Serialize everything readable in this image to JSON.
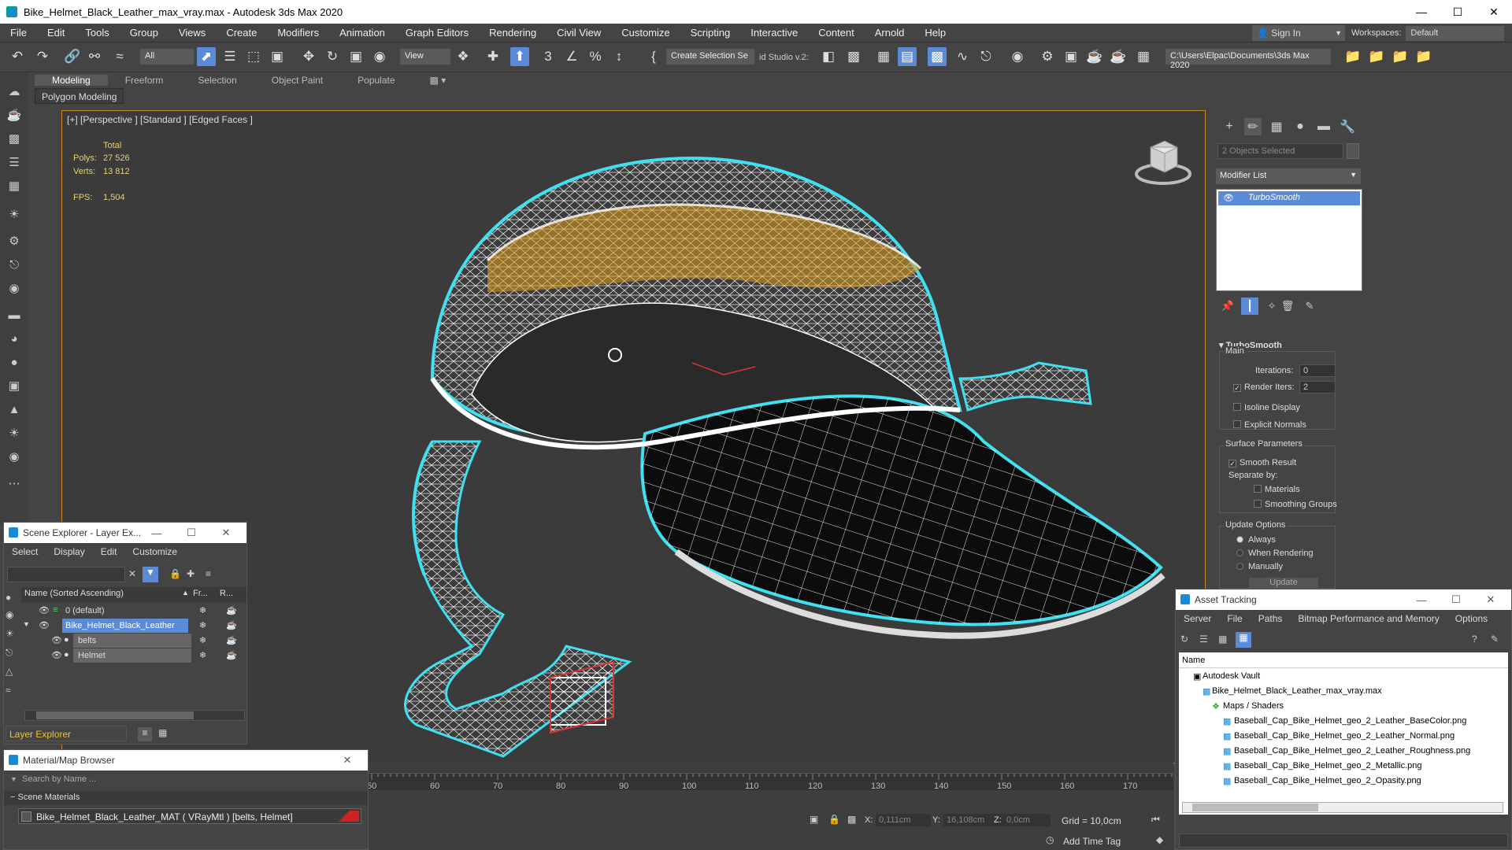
{
  "window": {
    "title": "Bike_Helmet_Black_Leather_max_vray.max - Autodesk 3ds Max 2020"
  },
  "menus": [
    "File",
    "Edit",
    "Tools",
    "Group",
    "Views",
    "Create",
    "Modifiers",
    "Animation",
    "Graph Editors",
    "Rendering",
    "Civil View",
    "Customize",
    "Scripting",
    "Interactive",
    "Content",
    "Arnold",
    "Help"
  ],
  "account": {
    "signin": "Sign In",
    "workspaces_label": "Workspaces:",
    "workspace": "Default"
  },
  "toolbar": {
    "filter": "All",
    "refcoord": "View",
    "selset": "Create Selection Se",
    "studio": "id Studio v.2:",
    "path": "C:\\Users\\Elpac\\Documents\\3ds Max 2020"
  },
  "ribbon": {
    "tabs": [
      "Modeling",
      "Freeform",
      "Selection",
      "Object Paint",
      "Populate"
    ],
    "sub": "Polygon Modeling"
  },
  "viewport": {
    "label": "[+] [Perspective ] [Standard ] [Edged Faces ]",
    "stats": {
      "total_label": "Total",
      "polys_label": "Polys:",
      "polys": "27 526",
      "verts_label": "Verts:",
      "verts": "13 812",
      "fps_label": "FPS:",
      "fps": "1,504"
    }
  },
  "command_panel": {
    "selected": "2 Objects Selected",
    "modifier_list": "Modifier List",
    "modifier": "TurboSmooth",
    "rollout": "TurboSmooth",
    "main": "Main",
    "iterations_label": "Iterations:",
    "iterations": "0",
    "render_iters_label": "Render Iters:",
    "render_iters": "2",
    "isoline": "Isoline Display",
    "explicit": "Explicit Normals",
    "surface": "Surface Parameters",
    "smooth_result": "Smooth Result",
    "separate_by": "Separate by:",
    "materials": "Materials",
    "smoothing_groups": "Smoothing Groups",
    "update_options": "Update Options",
    "always": "Always",
    "when_rendering": "When Rendering",
    "manually": "Manually",
    "update": "Update"
  },
  "scene_explorer": {
    "title": "Scene Explorer - Layer Ex...",
    "menu": [
      "Select",
      "Display",
      "Edit",
      "Customize"
    ],
    "col_name": "Name (Sorted Ascending)",
    "col_fr": "Fr...",
    "col_r": "R...",
    "rows": [
      {
        "name": "0 (default)"
      },
      {
        "name": "Bike_Helmet_Black_Leather"
      },
      {
        "name": "belts"
      },
      {
        "name": "Helmet"
      }
    ],
    "footer": "Layer Explorer"
  },
  "material_browser": {
    "title": "Material/Map Browser",
    "search": "Search by Name ...",
    "section": "Scene Materials",
    "item": "Bike_Helmet_Black_Leather_MAT  ( VRayMtl )  [belts, Helmet]"
  },
  "timeline": {
    "ticks": [
      "50",
      "60",
      "70",
      "80",
      "90",
      "100",
      "110",
      "120",
      "130",
      "140",
      "150",
      "160",
      "170"
    ],
    "x_label": "X:",
    "x": "0,111cm",
    "y_label": "Y:",
    "y": "16,108cm",
    "z_label": "Z:",
    "z": "0,0cm",
    "grid": "Grid = 10,0cm",
    "add_time_tag": "Add Time Tag"
  },
  "asset_tracking": {
    "title": "Asset Tracking",
    "menu": [
      "Server",
      "File",
      "Paths",
      "Bitmap Performance and Memory",
      "Options"
    ],
    "col_name": "Name",
    "rows": [
      {
        "name": "Autodesk Vault"
      },
      {
        "name": "Bike_Helmet_Black_Leather_max_vray.max"
      },
      {
        "name": "Maps / Shaders"
      },
      {
        "name": "Baseball_Cap_Bike_Helmet_geo_2_Leather_BaseColor.png"
      },
      {
        "name": "Baseball_Cap_Bike_Helmet_geo_2_Leather_Normal.png"
      },
      {
        "name": "Baseball_Cap_Bike_Helmet_geo_2_Leather_Roughness.png"
      },
      {
        "name": "Baseball_Cap_Bike_Helmet_geo_2_Metallic.png"
      },
      {
        "name": "Baseball_Cap_Bike_Helmet_geo_2_Opasity.png"
      }
    ]
  }
}
